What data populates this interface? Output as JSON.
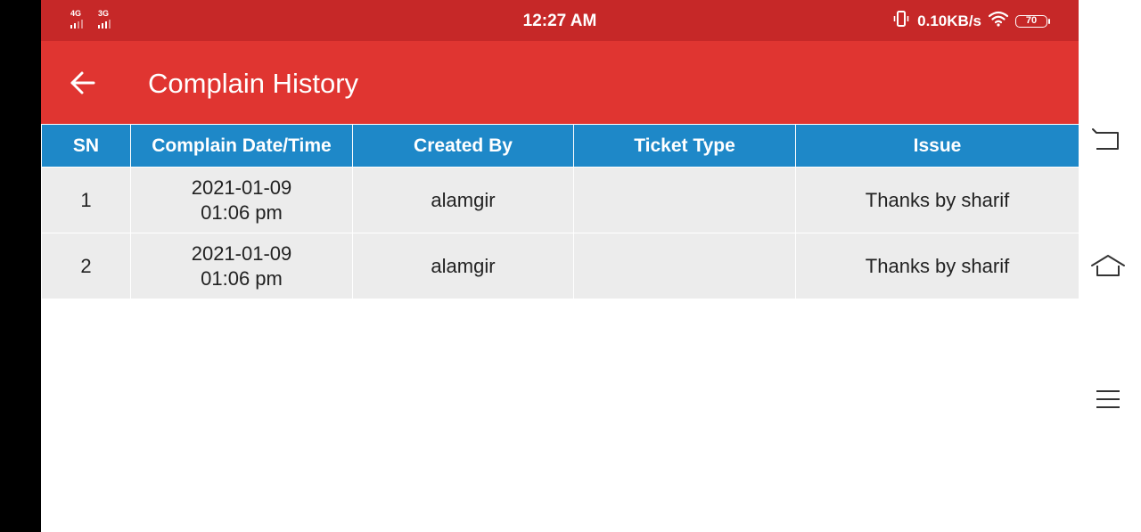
{
  "status_bar": {
    "network_1": "4G",
    "network_2": "3G",
    "time": "12:27 AM",
    "data_speed": "0.10KB/s",
    "battery_level": "70",
    "color": "#c62828"
  },
  "app_bar": {
    "title": "Complain History",
    "back_icon": "arrow-left-icon",
    "color": "#e03531"
  },
  "table": {
    "header_color": "#1e88c8",
    "columns": [
      "SN",
      "Complain Date/Time",
      "Created By",
      "Ticket Type",
      "Issue"
    ],
    "rows": [
      {
        "sn": "1",
        "date": "2021-01-09",
        "time": "01:06 pm",
        "created_by": "alamgir",
        "ticket_type": "",
        "issue": "Thanks by sharif"
      },
      {
        "sn": "2",
        "date": "2021-01-09",
        "time": "01:06 pm",
        "created_by": "alamgir",
        "ticket_type": "",
        "issue": "Thanks by sharif"
      }
    ]
  },
  "navigation": {
    "back_button": "back-nav-icon",
    "home_button": "home-nav-icon",
    "menu_button": "menu-nav-icon"
  }
}
